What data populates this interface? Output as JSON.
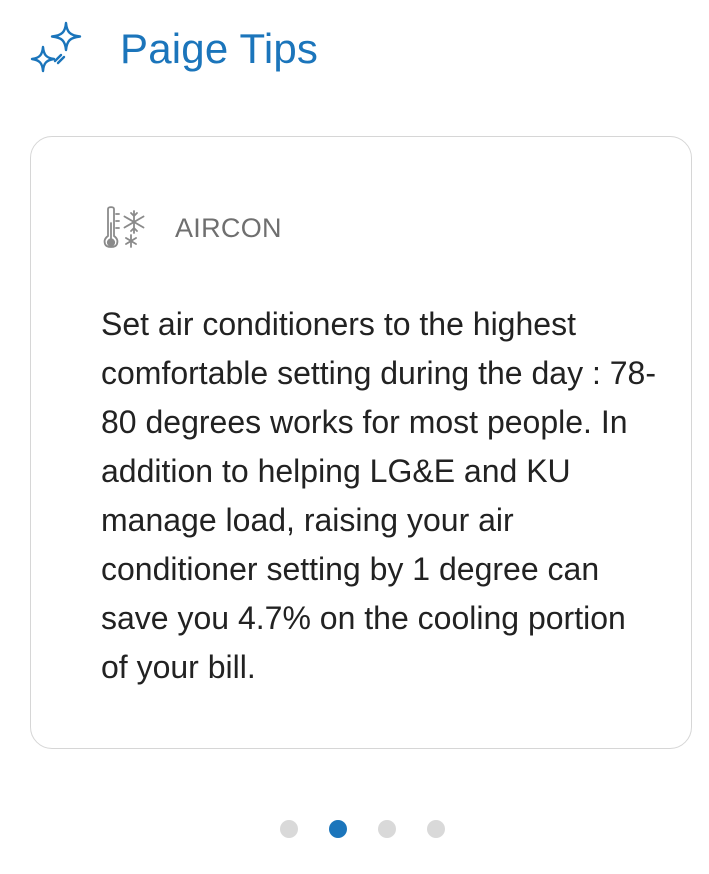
{
  "header": {
    "icon": "sparkle-icon",
    "title": "Paige Tips",
    "accent_color": "#1b75bb"
  },
  "tip_card": {
    "category_icon": "thermometer-snowflake-icon",
    "category_label": "AIRCON",
    "text": "Set air conditioners to the highest comfortable setting during the day : 78-80 degrees works for most people. In addition to helping LG&E and KU manage load, raising your air conditioner setting by 1 degree can save you 4.7% on the cooling portion of your bill."
  },
  "pager": {
    "total": 4,
    "active_index": 1,
    "active_color": "#1b75bb",
    "inactive_color": "#d9d9d9"
  }
}
